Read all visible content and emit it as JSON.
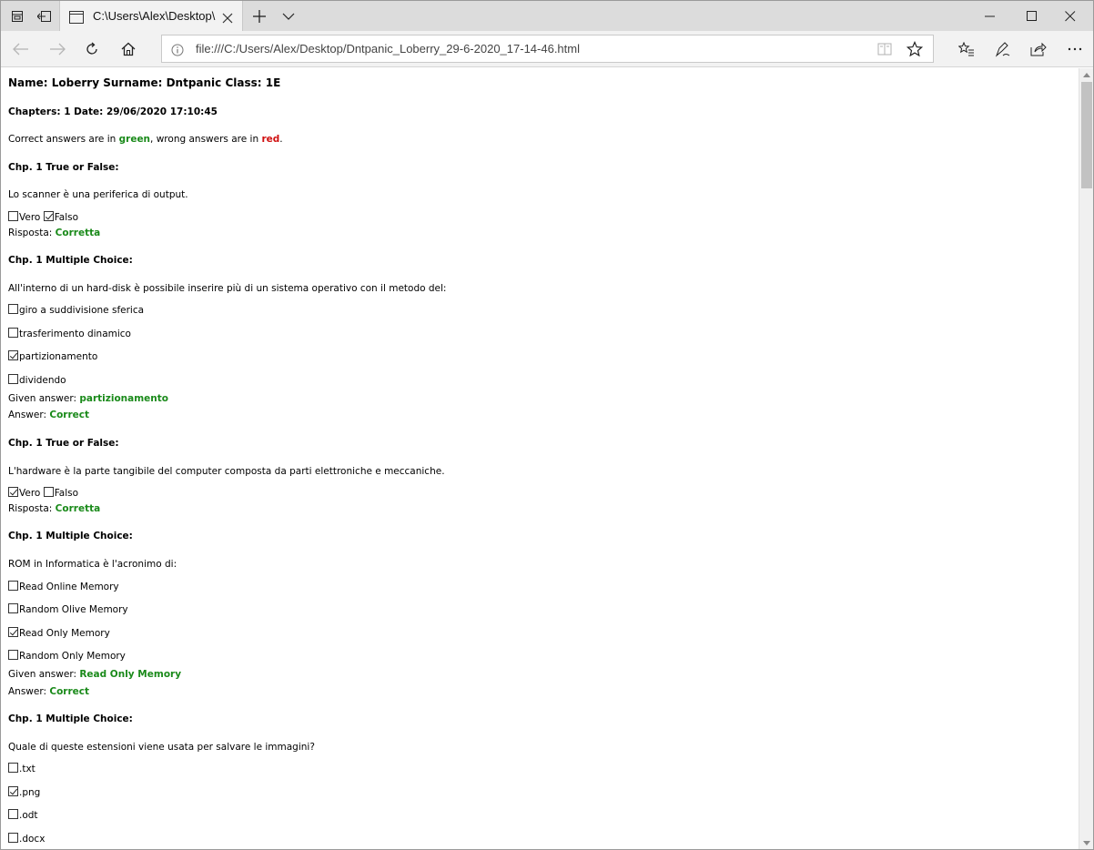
{
  "browser": {
    "tab_title": "C:\\Users\\Alex\\Desktop\\",
    "address": "file:///C:/Users/Alex/Desktop/Dntpanic_Loberry_29-6-2020_17-14-46.html"
  },
  "page": {
    "header": "Name: Loberry Surname: Dntpanic Class: 1E",
    "meta": "Chapters: 1 Date: 29/06/2020 17:10:45",
    "legend": {
      "prefix": "Correct answers are in ",
      "green_word": "green",
      "middle": ", wrong answers are in ",
      "red_word": "red",
      "suffix": "."
    },
    "q1": {
      "heading": "Chp. 1 True or False:",
      "question": "Lo scanner è una periferica di output.",
      "opt_a": "Vero",
      "opt_b": "Falso",
      "result_label": "Risposta: ",
      "result_value": "Corretta"
    },
    "q2": {
      "heading": "Chp. 1 Multiple Choice:",
      "question": "All'interno di un hard-disk è possibile inserire più di un sistema operativo con il metodo del:",
      "options": [
        "giro a suddivisione sferica",
        "trasferimento dinamico",
        "partizionamento",
        "dividendo"
      ],
      "given_label": "Given answer: ",
      "given_value": "partizionamento",
      "answer_label": "Answer: ",
      "answer_value": "Correct"
    },
    "q3": {
      "heading": "Chp. 1 True or False:",
      "question": "L'hardware è la parte tangibile del computer composta da parti elettroniche e meccaniche.",
      "opt_a": "Vero",
      "opt_b": "Falso",
      "result_label": "Risposta: ",
      "result_value": "Corretta"
    },
    "q4": {
      "heading": "Chp. 1 Multiple Choice:",
      "question": "ROM in Informatica è l'acronimo di:",
      "options": [
        "Read Online Memory",
        "Random Olive Memory",
        "Read Only Memory",
        "Random Only Memory"
      ],
      "given_label": "Given answer: ",
      "given_value": "Read Only Memory",
      "answer_label": "Answer: ",
      "answer_value": "Correct"
    },
    "q5": {
      "heading": "Chp. 1 Multiple Choice:",
      "question": "Quale di queste estensioni viene usata per salvare le immagini?",
      "options": [
        ".txt",
        ".png",
        ".odt",
        ".docx"
      ]
    }
  },
  "colors": {
    "correct": "#1a8a1a",
    "wrong": "#d01010"
  }
}
